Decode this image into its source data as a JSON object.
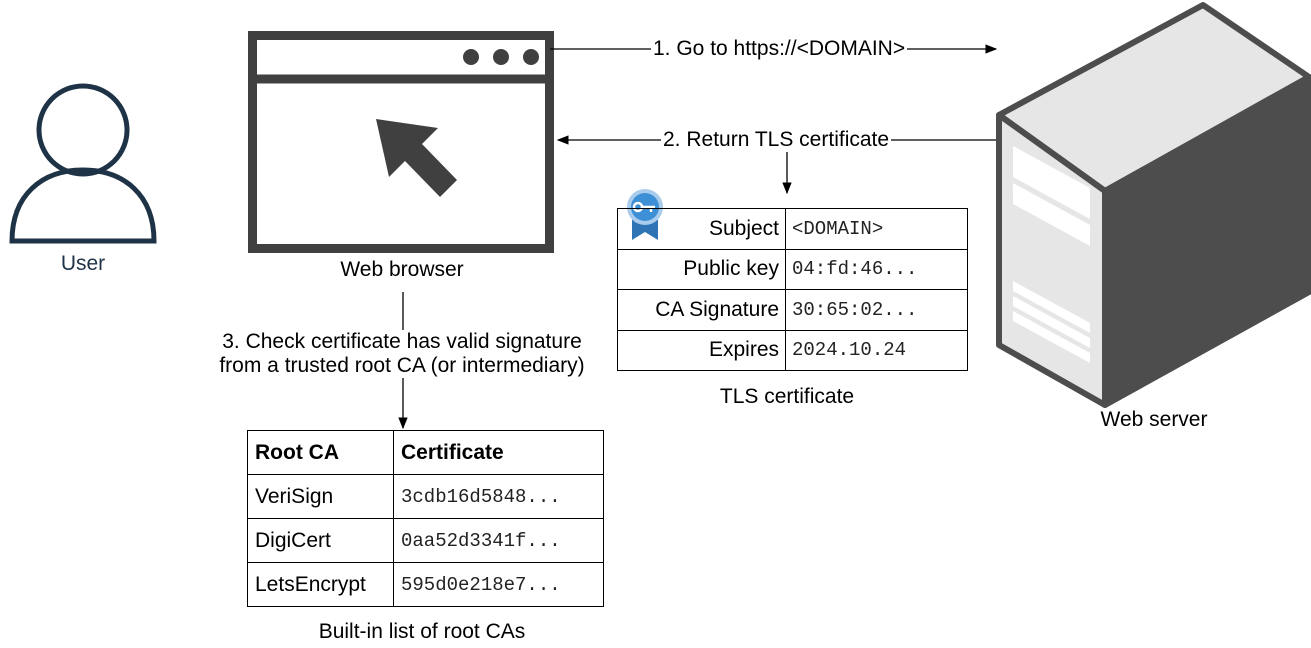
{
  "user": {
    "label": "User"
  },
  "browser": {
    "label": "Web browser"
  },
  "server": {
    "label": "Web server"
  },
  "steps": {
    "step1": "1. Go to https://<DOMAIN>",
    "step2": "2. Return TLS certificate",
    "step3_line1": "3. Check certificate has valid signature",
    "step3_line2": "from a trusted root CA (or intermediary)"
  },
  "tls_certificate": {
    "caption": "TLS certificate",
    "rows": [
      {
        "key": "Subject",
        "value": "<DOMAIN>"
      },
      {
        "key": "Public key",
        "value": "04:fd:46..."
      },
      {
        "key": "CA Signature",
        "value": "30:65:02..."
      },
      {
        "key": "Expires",
        "value": "2024.10.24"
      }
    ]
  },
  "root_ca_list": {
    "caption": "Built-in list of root CAs",
    "headers": [
      "Root CA",
      "Certificate"
    ],
    "rows": [
      {
        "name": "VeriSign",
        "cert": "3cdb16d5848..."
      },
      {
        "name": "DigiCert",
        "cert": "0aa52d3341f..."
      },
      {
        "name": "LetsEncrypt",
        "cert": "595d0e218e7..."
      }
    ]
  },
  "colors": {
    "user_icon": "#1f3347",
    "browser_icon": "#404040",
    "server_dark": "#4d4d4d",
    "server_light": "#e6e6e6",
    "badge_blue": "#3d8fd6"
  }
}
